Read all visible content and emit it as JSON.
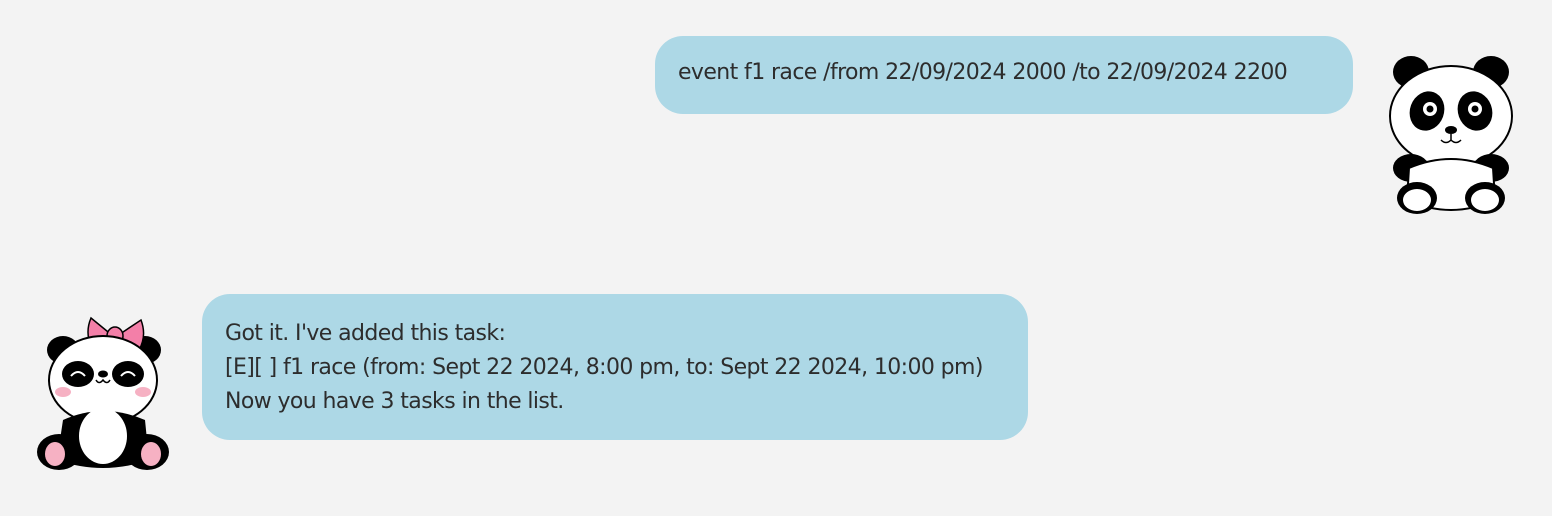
{
  "conversation": {
    "user_message": {
      "text": "event f1 race /from 22/09/2024 2000 /to 22/09/2024 2200",
      "avatar": "panda-avatar-icon"
    },
    "bot_message": {
      "lines": [
        "Got it. I've added this task:",
        "[E][ ] f1 race (from: Sept 22 2024, 8:00 pm, to: Sept 22 2024, 10:00 pm)",
        "Now you have 3 tasks in the list."
      ],
      "avatar": "panda-with-bow-avatar-icon"
    }
  },
  "colors": {
    "background": "#f3f3f3",
    "bubble": "#add8e6",
    "text": "#2d2d2d",
    "bow": "#f37fa8",
    "cheeks": "#f6b1c3"
  }
}
